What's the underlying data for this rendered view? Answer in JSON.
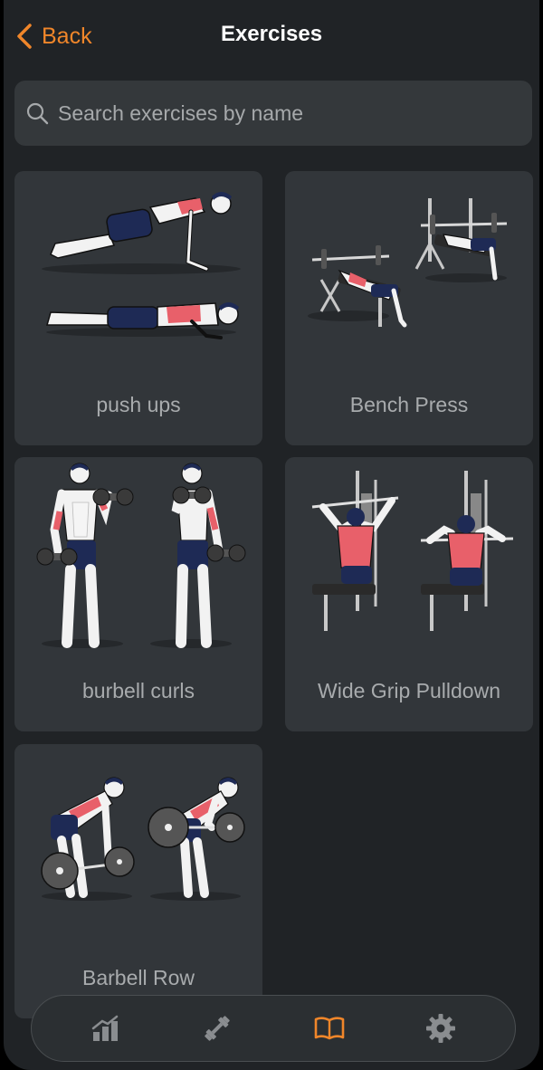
{
  "header": {
    "back_label": "Back",
    "title": "Exercises"
  },
  "search": {
    "placeholder": "Search exercises by name",
    "value": ""
  },
  "exercises": [
    {
      "name": "push ups"
    },
    {
      "name": "Bench Press"
    },
    {
      "name": "burbell curls"
    },
    {
      "name": "Wide Grip Pulldown"
    },
    {
      "name": "Barbell Row"
    }
  ],
  "tabbar": {
    "active": "library",
    "tabs": [
      {
        "icon": "stats-chart-icon"
      },
      {
        "icon": "dumbbell-icon"
      },
      {
        "icon": "book-icon"
      },
      {
        "icon": "gear-icon"
      }
    ]
  },
  "colors": {
    "accent": "#f0862a",
    "background": "#202326",
    "card": "#32363a",
    "muscle": "#e8606a",
    "shorts": "#1e2a55"
  }
}
